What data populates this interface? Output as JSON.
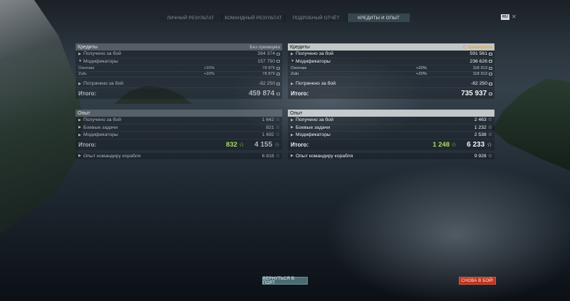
{
  "tabs": [
    {
      "label": "Личный результат",
      "active": false
    },
    {
      "label": "Командный результат",
      "active": false
    },
    {
      "label": "Подробный отчёт",
      "active": false
    },
    {
      "label": "Кредиты и опыт",
      "active": true
    }
  ],
  "topright": {
    "badge": "RU"
  },
  "left": {
    "credits": {
      "title": "Кредиты",
      "subtitle": "Без премиума",
      "earned_label": "Получено за бой",
      "earned_value": "384 374",
      "modifiers_label": "Модификаторы",
      "modifiers_value": "157 750",
      "mod1_label": "Охотник",
      "mod1_pct": "+20%",
      "mod1_value": "78 875",
      "mod2_label": "Zulu",
      "mod2_pct": "+20%",
      "mod2_value": "78 875",
      "spent_label": "Потрачено за бой",
      "spent_value": "-82 250",
      "total_label": "Итого:",
      "total_value": "459 874"
    },
    "xp": {
      "title": "Опыт",
      "earned_label": "Получено за бой",
      "earned_value": "1 642",
      "tasks_label": "Боевые задачи",
      "tasks_value": "821",
      "modifiers_label": "Модификаторы",
      "modifiers_value": "1 692",
      "total_label": "Итого:",
      "total_free": "832",
      "total_value": "4 155",
      "commander_label": "Опыт командиру корабля",
      "commander_value": "6 818"
    }
  },
  "right": {
    "credits": {
      "title": "Кредиты",
      "subtitle": "С премиумом",
      "earned_label": "Получено за бой",
      "earned_value": "591 561",
      "modifiers_label": "Модификаторы",
      "modifiers_value": "236 626",
      "mod1_label": "Охотник",
      "mod1_pct": "+20%",
      "mod1_value": "118 313",
      "mod2_label": "Zulu",
      "mod2_pct": "+20%",
      "mod2_value": "118 313",
      "spent_label": "Потрачено за бой",
      "spent_value": "-82 250",
      "total_label": "Итого:",
      "total_value": "735 937"
    },
    "xp": {
      "title": "Опыт",
      "earned_label": "Получено за бой",
      "earned_value": "2 463",
      "tasks_label": "Боевые задачи",
      "tasks_value": "1 232",
      "modifiers_label": "Модификаторы",
      "modifiers_value": "2 538",
      "total_label": "Итого:",
      "total_free": "1 248",
      "total_value": "6 233",
      "commander_label": "Опыт командиру корабля",
      "commander_value": "9 928"
    }
  },
  "buttons": {
    "port": "Вернуться в порт",
    "battle": "Снова в бой!"
  },
  "colors": {
    "accent_premium": "#e8a322",
    "free_xp": "#a7dc62",
    "battle_button": "#c0321c",
    "port_button": "#4a6b74"
  },
  "icons": {
    "credits": "credit-coin-icon",
    "xp": "xp-star-icon",
    "free_xp": "free-xp-star-icon"
  }
}
